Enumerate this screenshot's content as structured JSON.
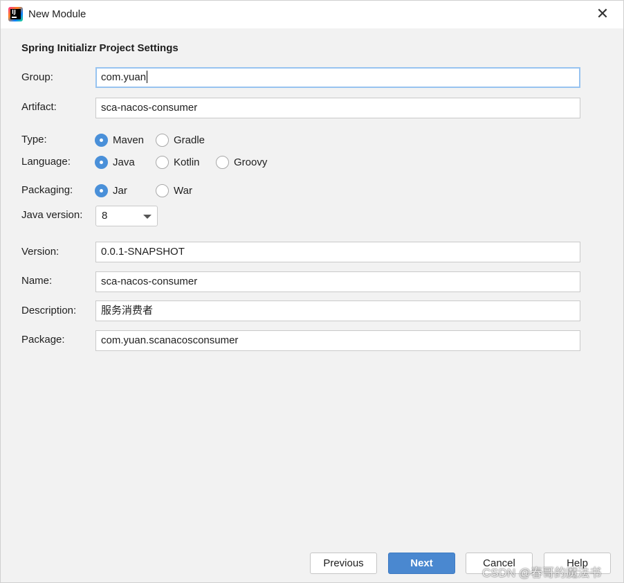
{
  "window": {
    "title": "New Module",
    "icon": "intellij-idea-icon",
    "close_glyph": "✕"
  },
  "section_title": "Spring Initializr Project Settings",
  "labels": {
    "group": "Group:",
    "artifact": "Artifact:",
    "type": "Type:",
    "language": "Language:",
    "packaging": "Packaging:",
    "java_version": "Java version:",
    "version": "Version:",
    "name": "Name:",
    "description": "Description:",
    "package": "Package:"
  },
  "fields": {
    "group": "com.yuan",
    "artifact": "sca-nacos-consumer",
    "version": "0.0.1-SNAPSHOT",
    "name": "sca-nacos-consumer",
    "description": "服务消费者",
    "package": "com.yuan.scanacosconsumer"
  },
  "type_options": [
    {
      "label": "Maven",
      "selected": true
    },
    {
      "label": "Gradle",
      "selected": false
    }
  ],
  "language_options": [
    {
      "label": "Java",
      "selected": true
    },
    {
      "label": "Kotlin",
      "selected": false
    },
    {
      "label": "Groovy",
      "selected": false
    }
  ],
  "packaging_options": [
    {
      "label": "Jar",
      "selected": true
    },
    {
      "label": "War",
      "selected": false
    }
  ],
  "java_version": {
    "selected": "8"
  },
  "buttons": {
    "previous": "Previous",
    "next": "Next",
    "cancel": "Cancel",
    "help": "Help"
  },
  "watermark": "CSDN @春哥的魔法书",
  "colors": {
    "accent": "#4a88d0",
    "focus_ring": "#97c3f0",
    "background": "#f2f2f2"
  }
}
